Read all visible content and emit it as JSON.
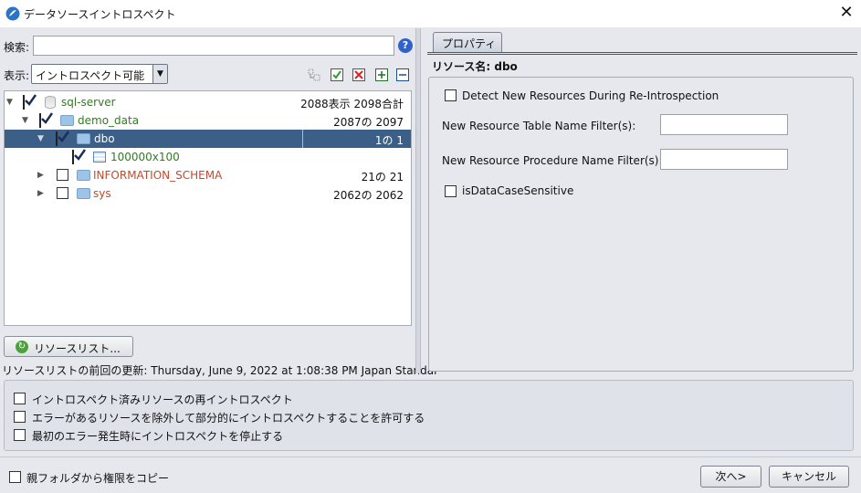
{
  "window": {
    "title": "データソースイントロスペクト",
    "close_label": "✕"
  },
  "search": {
    "label": "検索:",
    "value": "",
    "help_label": "?"
  },
  "view": {
    "label": "表示:",
    "selected": "イントロスペクト可能"
  },
  "toolbar_icons": [
    "tree-expand-icon",
    "check-all-icon",
    "uncheck-all-icon",
    "expand-all-icon",
    "collapse-all-icon"
  ],
  "tree": [
    {
      "label": "sql-server",
      "count": "2088表示 2098合計",
      "checked": true
    },
    {
      "label": "demo_data",
      "count": "2087の 2097",
      "checked": true
    },
    {
      "label": "dbo",
      "count": "1の 1",
      "checked": true,
      "selected": true
    },
    {
      "label": "100000x100",
      "count": "",
      "checked": true
    },
    {
      "label": "INFORMATION_SCHEMA",
      "count": "21の 21",
      "checked": false
    },
    {
      "label": "sys",
      "count": "2062の 2062",
      "checked": false
    }
  ],
  "resource_list_button": "リソースリスト...",
  "last_update": "リソースリストの前回の更新: Thursday, June 9, 2022 at 1:08:38 PM Japan Standar",
  "properties": {
    "tab_label": "プロパティ",
    "resource_name": "リソース名: dbo",
    "detect_new": "Detect New Resources During Re-Introspection",
    "table_filter_label": "New Resource Table Name Filter(s):",
    "table_filter_value": "",
    "procedure_filter_label": "New Resource Procedure Name Filter(s):",
    "procedure_filter_value": "",
    "case_sensitive": "isDataCaseSensitive"
  },
  "options": [
    "イントロスペクト済みリソースの再イントロスペクト",
    "エラーがあるリソースを除外して部分的にイントロスペクトすることを許可する",
    "最初のエラー発生時にイントロスペクトを停止する"
  ],
  "footer": {
    "copy_permissions": "親フォルダから権限をコピー",
    "next_button": "次へ>",
    "cancel_button": "キャンセル"
  },
  "colors": {
    "selection": "#3b5f86",
    "tree_green": "#2f7d1e",
    "tree_red": "#c14a2b",
    "help_blue": "#2f63c9"
  }
}
